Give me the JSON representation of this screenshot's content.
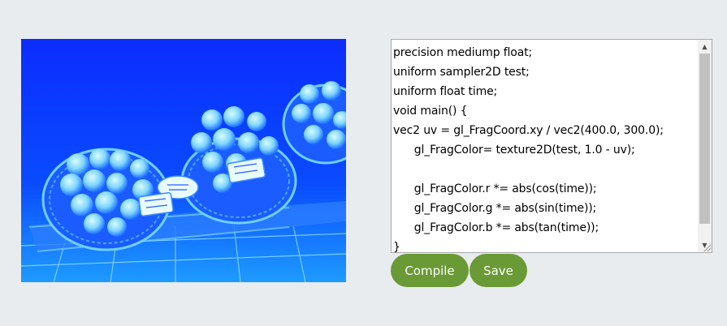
{
  "canvas": {
    "description_icon": "image-icon",
    "tint_color": "#0a38ff"
  },
  "editor": {
    "code_lines": [
      "precision mediump float;",
      "uniform sampler2D test;",
      "uniform float time;",
      "void main() {",
      "vec2 uv = gl_FragCoord.xy / vec2(400.0, 300.0);",
      "      gl_FragColor= texture2D(test, 1.0 - uv);",
      "",
      "      gl_FragColor.r *= abs(cos(time));",
      "      gl_FragColor.g *= abs(sin(time));",
      "      gl_FragColor.b *= abs(tan(time));",
      "}"
    ]
  },
  "buttons": {
    "compile_label": "Compile",
    "save_label": "Save"
  },
  "colors": {
    "background": "#e8ecef",
    "button": "#6a9a35",
    "button_text": "#ffffff"
  }
}
